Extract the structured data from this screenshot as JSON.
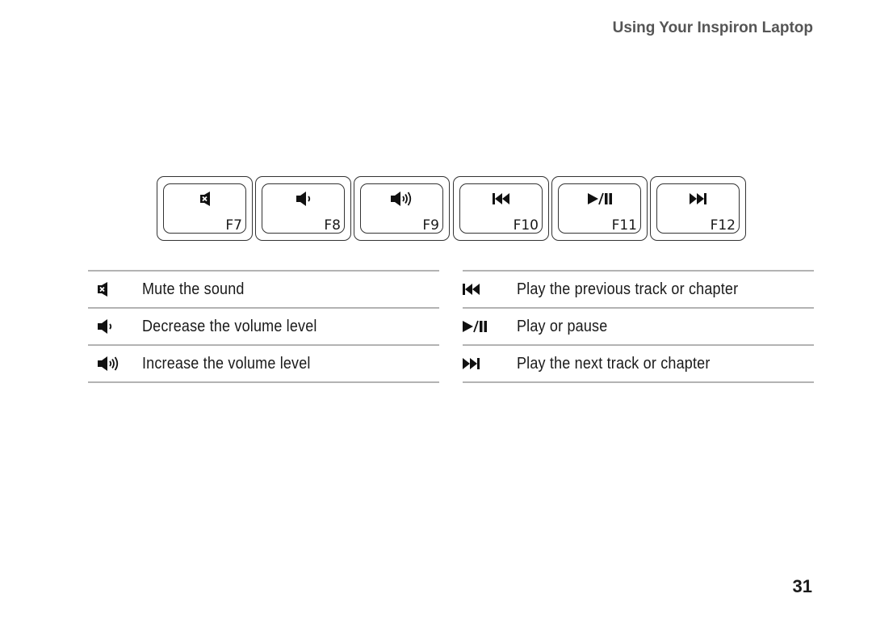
{
  "header": {
    "title": "Using Your Inspiron Laptop"
  },
  "keys": [
    {
      "label": "F7",
      "icon": "mute-icon"
    },
    {
      "label": "F8",
      "icon": "volume-down-icon"
    },
    {
      "label": "F9",
      "icon": "volume-up-icon"
    },
    {
      "label": "F10",
      "icon": "previous-track-icon"
    },
    {
      "label": "F11",
      "icon": "play-pause-icon"
    },
    {
      "label": "F12",
      "icon": "next-track-icon"
    }
  ],
  "legend_left": [
    {
      "icon": "mute-icon",
      "text": "Mute the sound"
    },
    {
      "icon": "volume-down-icon",
      "text": "Decrease the volume level"
    },
    {
      "icon": "volume-up-icon",
      "text": "Increase the volume level"
    }
  ],
  "legend_right": [
    {
      "icon": "previous-track-icon",
      "text": "Play the previous track or chapter"
    },
    {
      "icon": "play-pause-icon",
      "text": "Play or pause"
    },
    {
      "icon": "next-track-icon",
      "text": "Play the next track or chapter"
    }
  ],
  "footer": {
    "page_number": "31"
  },
  "colors": {
    "header_text": "#555555",
    "rule": "#b3b3b3",
    "ink": "#1a1a1a"
  }
}
